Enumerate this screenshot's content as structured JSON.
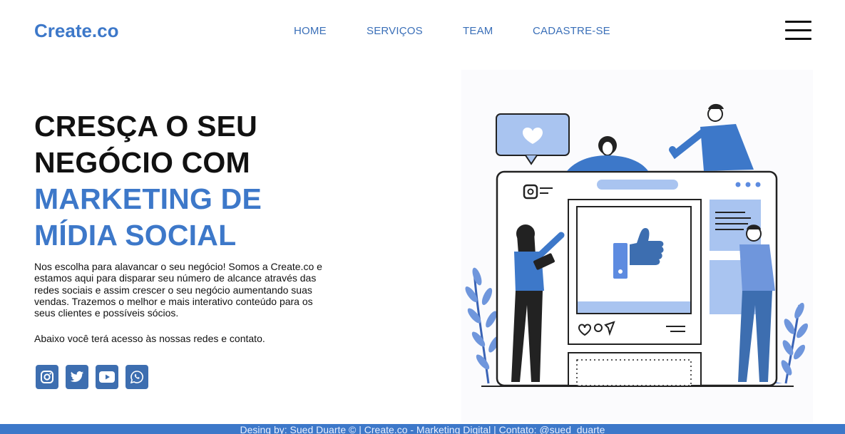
{
  "brand": {
    "logo": "Create.co",
    "accent_color": "#3d78c9"
  },
  "nav": {
    "items": [
      "HOME",
      "SERVIÇOS",
      "TEAM",
      "CADASTRE-SE"
    ],
    "menu_icon": "hamburger-menu-icon"
  },
  "hero": {
    "line1": "CRESÇA O SEU",
    "line2": "NEGÓCIO COM",
    "line3": "MARKETING DE",
    "line4": "MÍDIA SOCIAL",
    "description": "Nos escolha para alavancar o seu negócio! Somos a Create.co e estamos aqui para disparar seu número de alcance através das redes sociais e assim crescer o seu negócio aumentando suas vendas. Trazemos o melhor e mais interativo conteúdo para os seus clientes e possíveis sócios.",
    "access": "Abaixo você terá acesso às nossas redes e contato."
  },
  "social": [
    {
      "name": "instagram-icon"
    },
    {
      "name": "twitter-icon"
    },
    {
      "name": "youtube-icon"
    },
    {
      "name": "whatsapp-icon"
    }
  ],
  "footer": {
    "text": "Desing by: Sued Duarte © | Create.co - Marketing Digital | Contato: @sued_duarte"
  }
}
